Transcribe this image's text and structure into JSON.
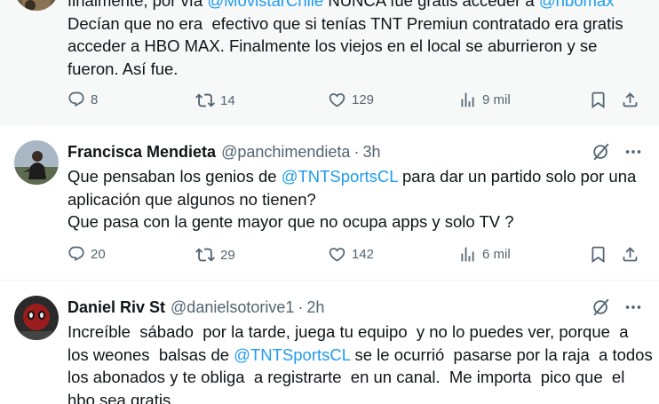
{
  "tweets": [
    {
      "body_lines": [
        [
          {
            "t": "finalmente, por vía "
          },
          {
            "t": "@MovistarChile",
            "m": true
          },
          {
            "t": " NUNCA fue gratis acceder a "
          },
          {
            "t": "@hbomax",
            "m": true
          }
        ],
        [
          {
            "t": "Decían que no era  efectivo que si tenías TNT Premiun contratado era gratis"
          }
        ],
        [
          {
            "t": "acceder a HBO MAX. Finalmente los viejos en el local se aburrieron y se"
          }
        ],
        [
          {
            "t": "fueron. Así fue."
          }
        ]
      ],
      "replies": "8",
      "retweets": "14",
      "likes": "129",
      "views": "9 mil"
    },
    {
      "name": "Francisca Mendieta",
      "handle": "@panchimendieta",
      "separator": "·",
      "time": "3h",
      "body_lines": [
        [
          {
            "t": "Que pensaban los genios de "
          },
          {
            "t": "@TNTSportsCL",
            "m": true
          },
          {
            "t": " para dar un partido solo por una"
          }
        ],
        [
          {
            "t": "aplicación que algunos no tienen?"
          }
        ],
        [
          {
            "t": "Que pasa con la gente mayor que no ocupa apps y solo TV ?"
          }
        ]
      ],
      "replies": "20",
      "retweets": "29",
      "likes": "142",
      "views": "6 mil"
    },
    {
      "name": "Daniel Riv St",
      "handle": "@danielsotorive1",
      "separator": "·",
      "time": "2h",
      "body_lines": [
        [
          {
            "t": "Increíble  sábado  por la tarde, juega tu equipo  y no lo puedes ver, porque  a"
          }
        ],
        [
          {
            "t": "los weones  balsas de "
          },
          {
            "t": "@TNTSportsCL",
            "m": true
          },
          {
            "t": " se le ocurrió  pasarse por la raja  a todos"
          }
        ],
        [
          {
            "t": "los abonados y te obliga  a registrarte  en un canal.  Me importa  pico que  el"
          }
        ],
        [
          {
            "t": "hbo sea gratis."
          }
        ]
      ]
    }
  ],
  "colors": {
    "accent": "#1d9bf0",
    "text": "#0f1419",
    "secondary": "#536471",
    "hover_background": "#f7f9f9"
  },
  "icons": [
    "reply-icon",
    "retweet-icon",
    "like-icon",
    "views-icon",
    "bookmark-icon",
    "share-icon",
    "grok-icon",
    "more-icon"
  ]
}
